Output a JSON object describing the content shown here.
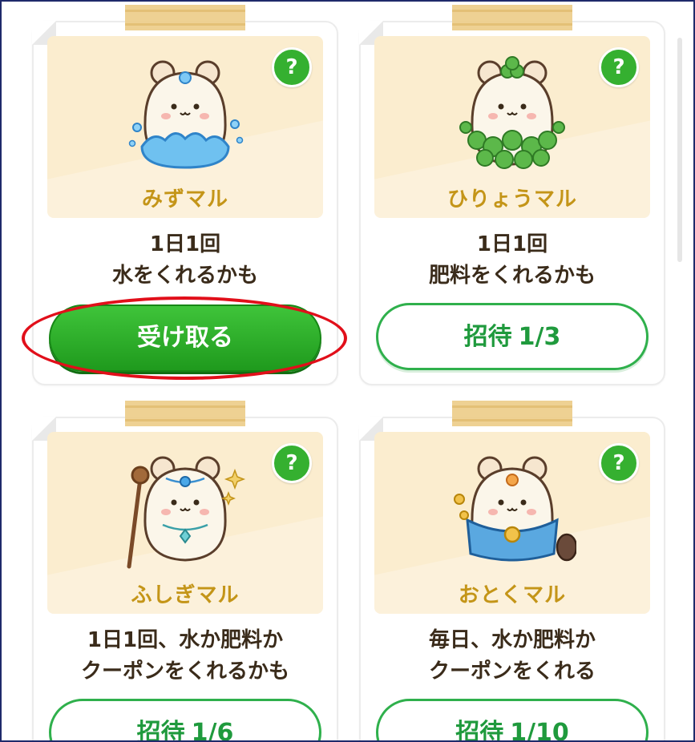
{
  "cards": [
    {
      "name": "みずマル",
      "desc_line1": "1日1回",
      "desc_line2": "水をくれるかも",
      "button": {
        "style": "filled",
        "label": "受け取る"
      },
      "help": "?"
    },
    {
      "name": "ひりょうマル",
      "desc_line1": "1日1回",
      "desc_line2": "肥料をくれるかも",
      "button": {
        "style": "outline",
        "label": "招待",
        "progress": "1/3"
      },
      "help": "?"
    },
    {
      "name": "ふしぎマル",
      "desc_line1": "1日1回、水か肥料か",
      "desc_line2": "クーポンをくれるかも",
      "button": {
        "style": "outline",
        "label": "招待",
        "progress": "1/6"
      },
      "help": "?"
    },
    {
      "name": "おとくマル",
      "desc_line1": "毎日、水か肥料か",
      "desc_line2": "クーポンをくれる",
      "button": {
        "style": "outline",
        "label": "招待",
        "progress": "1/10"
      },
      "help": "?"
    }
  ],
  "colors": {
    "accent_green": "#35b030",
    "name_gold": "#c49518",
    "panel_bg": "#fbedcf",
    "highlight_red": "#e10f1a"
  },
  "icons": [
    "water-hamster-icon",
    "clover-hamster-icon",
    "mystic-hamster-icon",
    "treasure-hamster-icon",
    "help-icon"
  ]
}
